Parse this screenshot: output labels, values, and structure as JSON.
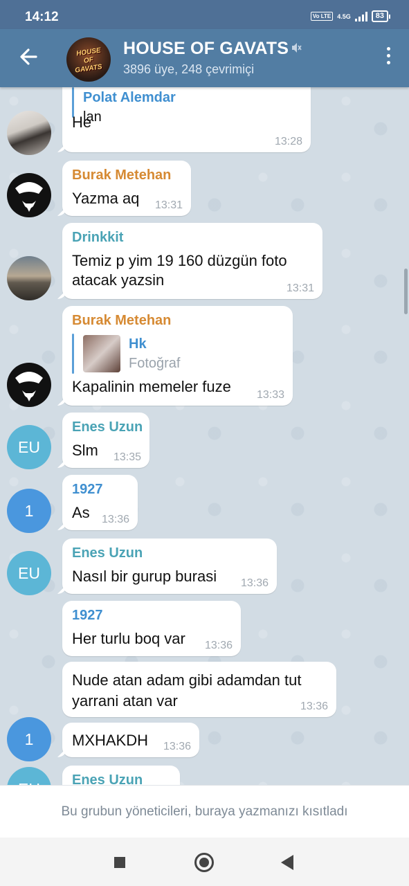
{
  "status_bar": {
    "time": "14:12",
    "volte": "Vo LTE",
    "network": "4.5G",
    "battery": "83"
  },
  "header": {
    "title": "HOUSE OF GAVATS",
    "subtitle": "3896 üye, 248 çevrimiçi",
    "avatar_text": "HOUSE OF GAVATS"
  },
  "colors": {
    "header": "#527da3",
    "status": "#4f7096",
    "name_orange": "#d68a33",
    "name_teal": "#4aa3b5",
    "name_blue": "#3f8fd0"
  },
  "messages": [
    {
      "sender": "Polat Alemdar",
      "text": "lan"
    },
    {
      "text": "He",
      "time": "13:28"
    },
    {
      "sender": "Burak Metehan",
      "text": "Yazma aq",
      "time": "13:31"
    },
    {
      "sender": "Drinkkit",
      "line1": "Temiz p yim 19 160 düzgün foto",
      "line2": "atacak yazsin",
      "time": "13:31"
    },
    {
      "sender": "Burak Metehan",
      "reply_name": "Hk",
      "reply_text": "Fotoğraf",
      "text": "Kapalinin memeler fuze",
      "time": "13:33"
    },
    {
      "sender": "Enes Uzun",
      "text": "Slm",
      "time": "13:35",
      "avatar": "EU"
    },
    {
      "sender": "1927",
      "text": "As",
      "time": "13:36",
      "avatar": "1"
    },
    {
      "sender": "Enes Uzun",
      "text": "Nasıl bir gurup burasi",
      "time": "13:36",
      "avatar": "EU"
    },
    {
      "sender": "1927",
      "text": "Her turlu boq var",
      "time": "13:36"
    },
    {
      "line1": "Nude atan adam gibi adamdan tut",
      "line2": "yarrani atan var",
      "time": "13:36"
    },
    {
      "text": "MXHAKDH",
      "time": "13:36",
      "avatar": "1"
    },
    {
      "sender": "Enes Uzun",
      "avatar": "EU"
    }
  ],
  "restriction": "Bu grubun yöneticileri, buraya yazmanızı kısıtladı"
}
